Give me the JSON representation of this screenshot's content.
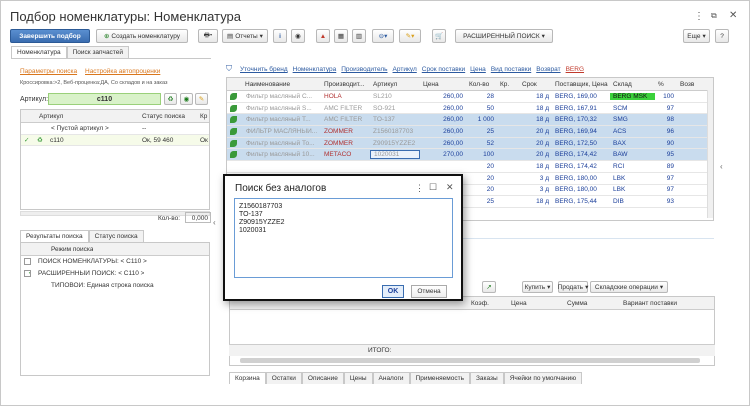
{
  "window": {
    "title": "Подбор номенклатуры: Номенклатура",
    "menu_icon": "more-vertical-icon",
    "restore_icon": "restore-icon",
    "close_icon": "close-icon"
  },
  "toolbar": {
    "finish_label": "Завершить подбор",
    "create_label": "Создать номенклатуру",
    "reports_label": "Отчеты",
    "ext_search_label": "РАСШИРЕННЫЙ ПОИСК",
    "more_label": "Еще",
    "help_label": "?"
  },
  "left_tabs": [
    "Номенклатура",
    "Поиск запчастей"
  ],
  "left": {
    "search_params": "Параметры поиска",
    "auto_settings": "Настройка автопроценки",
    "cross_info": "Кроссировка:>2, Веб-проценка:ДА, Со складов и на заказ",
    "article_label": "Артикул:",
    "article_value": "c110",
    "col_article": "Артикул",
    "col_status": "Статус поиска",
    "col_cr": "Кр",
    "empty_row": "< Пустой артикул >",
    "empty_status": "--",
    "row_article": "c110",
    "row_status": "Ок, 59 460",
    "row_cr": "Ок",
    "qty_label": "Кол-во:",
    "qty_value": "0,000"
  },
  "result_tabs": [
    "Результаты поиска",
    "Статус поиска"
  ],
  "results": {
    "header": "Режим поиска",
    "rows": [
      "ПОИСК НОМЕНКЛАТУРЫ: < C110 >",
      "РАСШИРЕННЫЙ ПОИСК: < C110 >",
      "ТИПОВОЙ: Единая строка поиска"
    ]
  },
  "right_links": [
    "Уточнить бренд",
    "Номенклатура",
    "Производитель",
    "Артикул",
    "Срок поставки",
    "Цена",
    "Вид поставки",
    "Возврат",
    "BERG"
  ],
  "table": {
    "headers": [
      "Наименование",
      "Производит...",
      "Артикул",
      "Цена",
      "Кол-во",
      "Кр.",
      "Срок",
      "Поставщик, Цена",
      "Склад",
      "%",
      "Возв"
    ],
    "rows": [
      {
        "name": "Фильтр масляный С...",
        "maker": "HOLA",
        "art": "SL210",
        "price": "260,00",
        "qty": "28",
        "term": "18 д",
        "supplier": "BERG, 169,00",
        "stock": "BERG MSK",
        "pct": "100"
      },
      {
        "name": "Фильтр масляный S...",
        "maker": "AMC FILTER",
        "art": "SO-921",
        "price": "260,00",
        "qty": "50",
        "term": "18 д",
        "supplier": "BERG, 167,91",
        "stock": "SCM",
        "pct": "97"
      },
      {
        "name": "Фильтр масляный Т...",
        "maker": "AMC FILTER",
        "art": "TO-137",
        "price": "260,00",
        "qty": "1 000",
        "term": "18 д",
        "supplier": "BERG, 170,32",
        "stock": "SMG",
        "pct": "98"
      },
      {
        "name": "ФИЛЬТР МАСЛЯНЫЙ...",
        "maker": "ZOMMER",
        "art": "Z1560187703",
        "price": "260,00",
        "qty": "25",
        "term": "20 д",
        "supplier": "BERG, 169,94",
        "stock": "ACS",
        "pct": "96"
      },
      {
        "name": "Фильтр масляный То...",
        "maker": "ZOMMER",
        "art": "Z90915YZZE2",
        "price": "260,00",
        "qty": "52",
        "term": "20 д",
        "supplier": "BERG, 172,50",
        "stock": "BAX",
        "pct": "90"
      },
      {
        "name": "Фильтр масляный 10...",
        "maker": "METACO",
        "art": "1020031",
        "price": "270,00",
        "qty": "100",
        "term": "20 д",
        "supplier": "BERG, 174,42",
        "stock": "BAW",
        "pct": "95"
      },
      {
        "name": "",
        "maker": "",
        "art": "",
        "price": "",
        "qty": "20",
        "term": "18 д",
        "supplier": "BERG, 174,42",
        "stock": "RCI",
        "pct": "89"
      },
      {
        "name": "",
        "maker": "",
        "art": "",
        "price": "",
        "qty": "20",
        "term": "3 д",
        "supplier": "BERG, 180,00",
        "stock": "LBK",
        "pct": "97"
      },
      {
        "name": "",
        "maker": "",
        "art": "",
        "price": "",
        "qty": "20",
        "term": "3 д",
        "supplier": "BERG, 180,00",
        "stock": "LBK",
        "pct": "97"
      },
      {
        "name": "",
        "maker": "",
        "art": "",
        "price": "",
        "qty": "25",
        "term": "18 д",
        "supplier": "BERG, 175,44",
        "stock": "DIB",
        "pct": "93"
      }
    ]
  },
  "cart": {
    "buy_label": "Купить",
    "sell_label": "Продать",
    "ops_label": "Складские операции",
    "headers": [
      "Коэф.",
      "Цена",
      "Сумма",
      "Вариант поставки"
    ],
    "total_label": "ИТОГО:"
  },
  "bottom_tabs": [
    "Корзина",
    "Остатки",
    "Описание",
    "Цены",
    "Аналоги",
    "Применяемость",
    "Заказы",
    "Ячейки по умолчанию"
  ],
  "dialog": {
    "title": "Поиск без аналогов",
    "lines": [
      "Z1560187703",
      "TO-137",
      "Z90915YZZE2",
      "1020031"
    ],
    "ok_label": "OK",
    "cancel_label": "Отмена"
  },
  "colors": {
    "primary_button": "#3a6db0",
    "stock_highlight": "#3bd13b",
    "selected_row": "#c9dcee",
    "link_orange": "#d9761c"
  }
}
